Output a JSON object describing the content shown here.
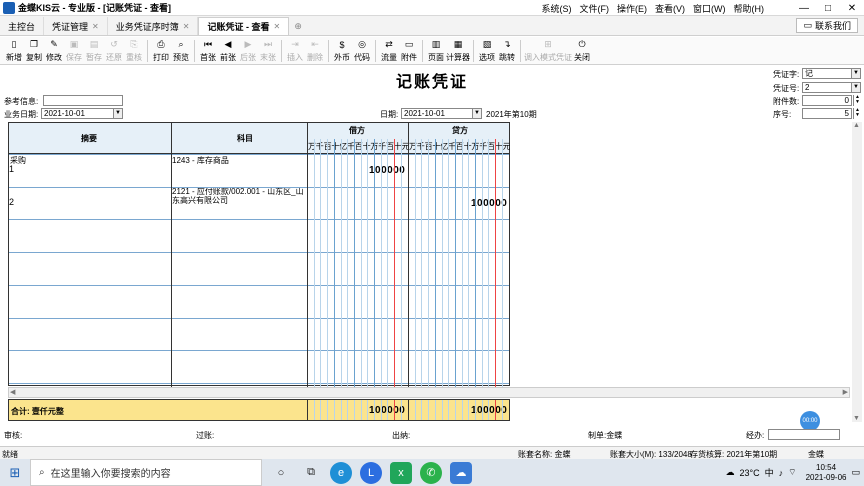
{
  "window": {
    "title": "金蝶KIS云 - 专业版 - [记账凭证 - 查看]",
    "menu": [
      "系统(S)",
      "文件(F)",
      "操作(E)",
      "查看(V)",
      "窗口(W)",
      "帮助(H)"
    ],
    "controls": [
      "—",
      "□",
      "✕"
    ]
  },
  "tabs": [
    {
      "label": "主控台",
      "closable": false,
      "active": false
    },
    {
      "label": "凭证管理",
      "closable": true,
      "active": false
    },
    {
      "label": "业务凭证序时簿",
      "closable": true,
      "active": false
    },
    {
      "label": "记账凭证 - 查看",
      "closable": true,
      "active": true
    }
  ],
  "contact_label": "联系我们",
  "toolbar": [
    {
      "label": "新增",
      "icon": "new-icon",
      "glyph": "▯",
      "enabled": true
    },
    {
      "label": "复制",
      "icon": "copy-icon",
      "glyph": "❐",
      "enabled": true
    },
    {
      "label": "修改",
      "icon": "edit-icon",
      "glyph": "✎",
      "enabled": true
    },
    {
      "label": "保存",
      "icon": "save-icon",
      "glyph": "▣",
      "enabled": false
    },
    {
      "label": "暂存",
      "icon": "temp-save-icon",
      "glyph": "▤",
      "enabled": false
    },
    {
      "label": "还原",
      "icon": "restore-icon",
      "glyph": "↺",
      "enabled": false
    },
    {
      "label": "重核",
      "icon": "recheck-icon",
      "glyph": "⎘",
      "enabled": false
    },
    {
      "label": "打印",
      "icon": "print-icon",
      "glyph": "⎙",
      "enabled": true
    },
    {
      "label": "预览",
      "icon": "preview-icon",
      "glyph": "⌕",
      "enabled": true
    },
    {
      "label": "首张",
      "icon": "first-icon",
      "glyph": "⏮",
      "enabled": true
    },
    {
      "label": "前张",
      "icon": "prev-icon",
      "glyph": "◀",
      "enabled": true
    },
    {
      "label": "后张",
      "icon": "next-icon",
      "glyph": "▶",
      "enabled": false
    },
    {
      "label": "末张",
      "icon": "last-icon",
      "glyph": "⏭",
      "enabled": false
    },
    {
      "label": "插入",
      "icon": "insert-icon",
      "glyph": "⇥",
      "enabled": false
    },
    {
      "label": "删除",
      "icon": "delete-icon",
      "glyph": "⇤",
      "enabled": false
    },
    {
      "label": "外币",
      "icon": "currency-icon",
      "glyph": "$",
      "enabled": true
    },
    {
      "label": "代码",
      "icon": "code-icon",
      "glyph": "◎",
      "enabled": true
    },
    {
      "label": "流量",
      "icon": "flow-icon",
      "glyph": "⇄",
      "enabled": true
    },
    {
      "label": "附件",
      "icon": "attachment-icon",
      "glyph": "▭",
      "enabled": true
    },
    {
      "label": "页面",
      "icon": "page-icon",
      "glyph": "▥",
      "enabled": true
    },
    {
      "label": "计算器",
      "icon": "calculator-icon",
      "glyph": "▦",
      "enabled": true
    },
    {
      "label": "选项",
      "icon": "options-icon",
      "glyph": "▧",
      "enabled": true
    },
    {
      "label": "跳转",
      "icon": "jump-icon",
      "glyph": "↴",
      "enabled": true
    },
    {
      "label": "调入模式凭证",
      "icon": "import-template-icon",
      "glyph": "⊞",
      "enabled": false
    },
    {
      "label": "关闭",
      "icon": "close-icon",
      "glyph": "⏻",
      "enabled": true
    }
  ],
  "voucher": {
    "title": "记账凭证",
    "ref_label": "参考信息:",
    "ref_value": "",
    "biz_date_label": "业务日期:",
    "biz_date": "2021-10-01",
    "date_label": "日期:",
    "date": "2021-10-01",
    "period": "2021年第10期",
    "type_label": "凭证字:",
    "type_value": "记",
    "no_label": "凭证号:",
    "no_value": "2",
    "attach_label": "附件数:",
    "attach_value": "0",
    "seq_label": "序号:",
    "seq_value": "5"
  },
  "grid": {
    "col_summary": "摘要",
    "col_account": "科目",
    "col_debit": "借方",
    "col_credit": "贷方",
    "digit_header": "万千百十亿千百十万千百十元角分",
    "rows": [
      {
        "no": "1",
        "summary": "采购",
        "account": "1243 - 库存商品",
        "debit": "100000",
        "credit": ""
      },
      {
        "no": "2",
        "summary": "",
        "account": "2121 - 应付账款/002.001 - 山东区_山东高兴有限公司",
        "debit": "",
        "credit": "100000"
      }
    ],
    "total_label": "合计: 壹仟元整",
    "total_debit": "100000",
    "total_credit": "100000"
  },
  "signatures": {
    "audit": "审核:",
    "post": "过账:",
    "cashier": "出纳:",
    "maker": "制单:金蝶",
    "handler": "经办:"
  },
  "bubble_text": "00:00",
  "status": {
    "ready": "就绪",
    "account_name": "账套名称: 金蝶",
    "account_size": "账套大小(M): 133/2048",
    "inventory_period": "存货核算: 2021年第10期",
    "user": "金蝶"
  },
  "taskbar": {
    "search_placeholder": "在这里输入你要搜索的内容",
    "weather": "23°C",
    "ime": "中",
    "time": "10:54",
    "date": "2021-09-06"
  }
}
